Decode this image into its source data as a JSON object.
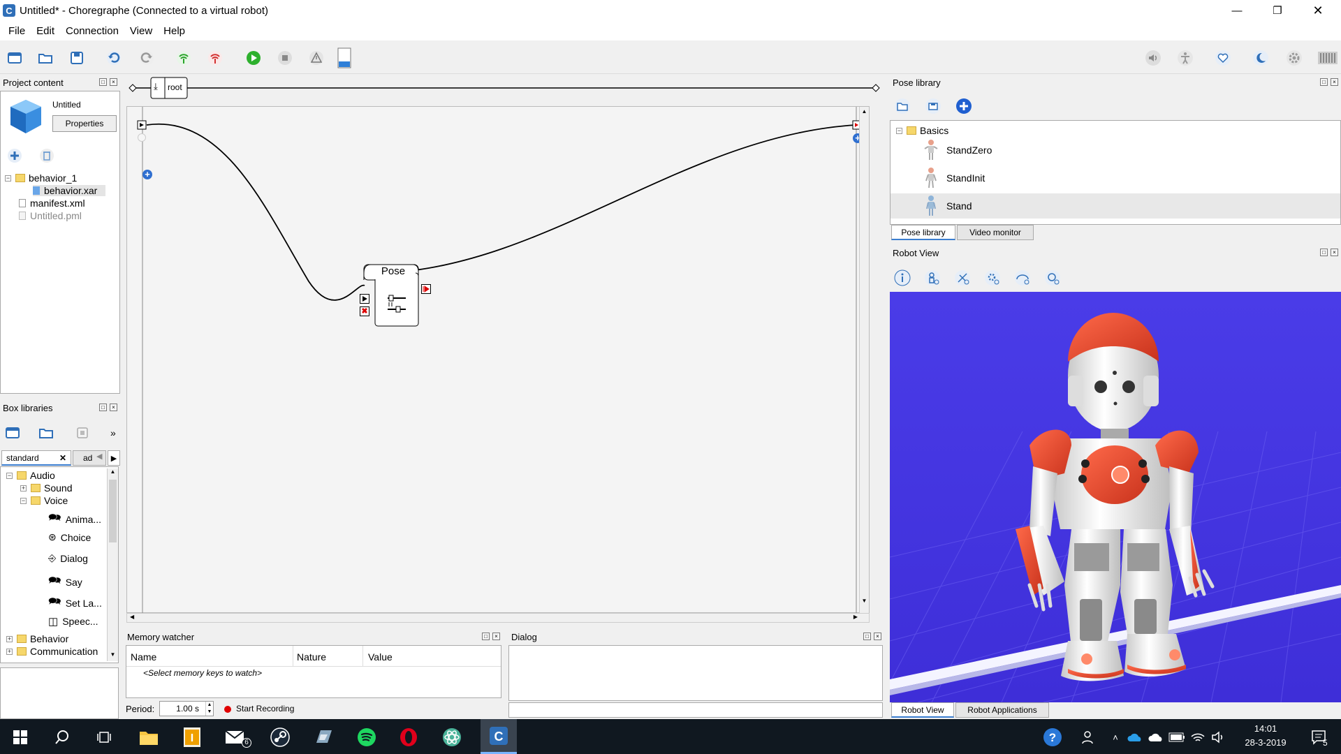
{
  "window": {
    "title": "Untitled* - Choregraphe (Connected to a virtual robot)",
    "app_icon_letter": "C"
  },
  "menu": [
    "File",
    "Edit",
    "Connection",
    "View",
    "Help"
  ],
  "toolbar_icons": [
    "new-project-icon",
    "open-project-icon",
    "save-project-icon",
    "undo-icon",
    "redo-icon",
    "connect-icon",
    "disconnect-icon",
    "play-icon",
    "stop-icon",
    "debug-warning-icon",
    "battery-indicator-icon"
  ],
  "toolbar_right_icons": [
    "volume-icon",
    "animation-mode-icon",
    "autonomous-life-icon",
    "rest-icon",
    "settings-gear-icon",
    "battery-icon"
  ],
  "project_content": {
    "title": "Project content",
    "project_name": "Untitled",
    "properties_label": "Properties",
    "tree": [
      {
        "label": "behavior_1",
        "type": "folder",
        "level": 0,
        "expander": "−"
      },
      {
        "label": "behavior.xar",
        "type": "file",
        "level": 1,
        "selected": true
      },
      {
        "label": "manifest.xml",
        "type": "file",
        "level": 0
      },
      {
        "label": "Untitled.pml",
        "type": "file",
        "level": 0,
        "dim": true
      }
    ]
  },
  "box_libraries": {
    "title": "Box libraries",
    "tabs": [
      "standard",
      "ad"
    ],
    "tree": [
      {
        "label": "Audio",
        "type": "folder",
        "level": 0,
        "expander": "−"
      },
      {
        "label": "Sound",
        "type": "folder",
        "level": 1,
        "expander": "+"
      },
      {
        "label": "Voice",
        "type": "folder",
        "level": 1,
        "expander": "−"
      },
      {
        "label": "Anima...",
        "type": "box",
        "level": 2
      },
      {
        "label": "Choice",
        "type": "box",
        "level": 2
      },
      {
        "label": "Dialog",
        "type": "box",
        "level": 2
      },
      {
        "label": "Say",
        "type": "box",
        "level": 2
      },
      {
        "label": "Set La...",
        "type": "box",
        "level": 2
      },
      {
        "label": "Speec...",
        "type": "box",
        "level": 2
      },
      {
        "label": "Behavior",
        "type": "folder",
        "level": 0,
        "expander": "+"
      },
      {
        "label": "Communication",
        "type": "folder",
        "level": 0,
        "expander": "+"
      }
    ]
  },
  "flow": {
    "breadcrumb": "root",
    "box_label": "Pose"
  },
  "memory_watcher": {
    "title": "Memory watcher",
    "columns": [
      "Name",
      "Nature",
      "Value"
    ],
    "placeholder": "<Select memory keys to watch>",
    "period_label": "Period:",
    "period_value": "1.00 s",
    "record_label": "Start Recording",
    "record_color": "#e00000"
  },
  "dialog": {
    "title": "Dialog"
  },
  "pose_library": {
    "title": "Pose library",
    "group": "Basics",
    "poses": [
      "StandZero",
      "StandInit",
      "Stand"
    ],
    "tabs": [
      "Pose library",
      "Video monitor"
    ]
  },
  "robot_view": {
    "title": "Robot View",
    "tabs": [
      "Robot View",
      "Robot Applications"
    ],
    "background": "#4434e0",
    "accent": "#e8442a"
  },
  "taskbar": {
    "apps": [
      "windows-start-icon",
      "search-icon",
      "task-view-icon",
      "file-explorer-icon",
      "impress-app-icon",
      "mail-icon",
      "steam-icon",
      "app-icon",
      "spotify-icon",
      "opera-icon",
      "atom-icon",
      "choregraphe-icon"
    ],
    "mail_badge": "6",
    "time": "14:01",
    "date": "28-3-2019",
    "notification_count": "5"
  }
}
